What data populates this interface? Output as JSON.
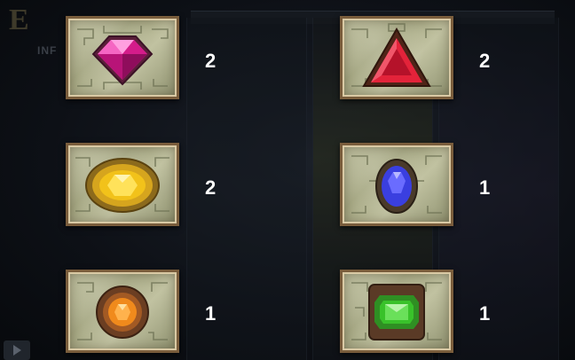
{
  "background": {
    "logo_fragment": "E",
    "info_fragment": "INF"
  },
  "paytable": [
    {
      "symbol": "pink-diamond-gem",
      "count": "2",
      "gem_color": "#e0309a"
    },
    {
      "symbol": "red-triangle-gem",
      "count": "2",
      "gem_color": "#e3233a"
    },
    {
      "symbol": "yellow-oval-gem",
      "count": "2",
      "gem_color": "#f2c21a"
    },
    {
      "symbol": "blue-oval-gem",
      "count": "1",
      "gem_color": "#3a3fe0"
    },
    {
      "symbol": "orange-round-gem",
      "count": "1",
      "gem_color": "#f08a1c"
    },
    {
      "symbol": "green-square-gem",
      "count": "1",
      "gem_color": "#39c22a"
    }
  ]
}
